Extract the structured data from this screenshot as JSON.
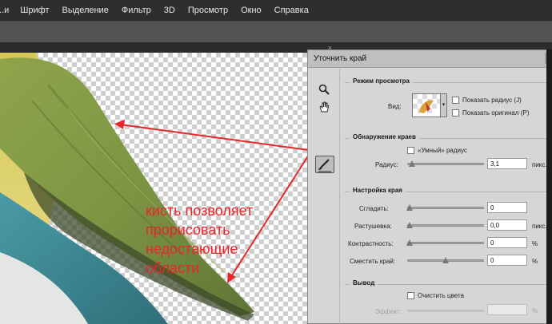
{
  "menu": {
    "items": [
      "...и",
      "Шрифт",
      "Выделение",
      "Фильтр",
      "3D",
      "Просмотр",
      "Окно",
      "Справка"
    ]
  },
  "tabstrip": {
    "arrows": "»"
  },
  "annotation": {
    "lines": [
      "кисть позволяет",
      "прорисовать",
      "недостающие",
      "области"
    ]
  },
  "dialog": {
    "title": "Уточнить край",
    "view_mode": {
      "title": "Режим просмотра",
      "view_label": "Вид:",
      "show_radius": "Показать радиус (J)",
      "show_original": "Показать оригинал (P)"
    },
    "edge_detection": {
      "title": "Обнаружение краев",
      "smart_radius": "«Умный» радиус",
      "radius_label": "Радиус:",
      "radius_value": "3,1",
      "radius_unit": "пикс.",
      "radius_level": 0.05
    },
    "adjust_edge": {
      "title": "Настройка края",
      "smooth_label": "Сгладить:",
      "smooth_value": "0",
      "feather_label": "Растушевка:",
      "feather_value": "0,0",
      "feather_unit": "пикс.",
      "contrast_label": "Контрастность:",
      "contrast_value": "0",
      "contrast_unit": "%",
      "shift_label": "Сместить край:",
      "shift_value": "0",
      "shift_unit": "%",
      "shift_level": 0.5
    },
    "output": {
      "title": "Вывод",
      "decontaminate": "Очистить цвета",
      "effect_label": "Эффект:",
      "effect_unit": "%"
    }
  },
  "colors": {
    "arrow": "#e8262a",
    "canvas_checker": "#cfcfcf",
    "dialog_bg": "#d6d6d6"
  },
  "icons": [
    "zoom-icon",
    "hand-icon",
    "refine-brush-icon",
    "view-preview-icon"
  ]
}
